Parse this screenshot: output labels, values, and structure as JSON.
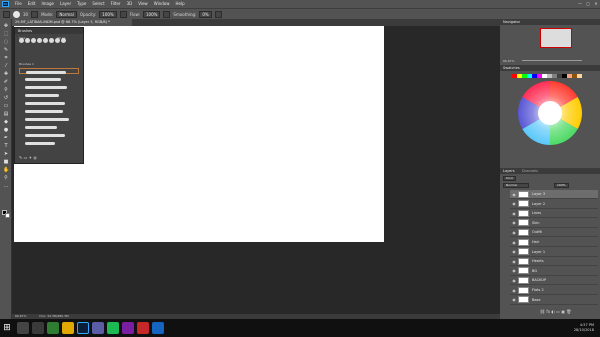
{
  "app": {
    "logo": "Ps",
    "menu": [
      "File",
      "Edit",
      "Image",
      "Layer",
      "Type",
      "Select",
      "Filter",
      "3D",
      "View",
      "Window",
      "Help"
    ],
    "window_controls": [
      "—",
      "▢",
      "✕"
    ]
  },
  "options": {
    "brush_size": "30",
    "mode_label": "Mode:",
    "mode_value": "Normal",
    "opacity_label": "Opacity:",
    "opacity_value": "100%",
    "flow_label": "Flow:",
    "flow_value": "100%",
    "smoothing_label": "Smoothing:",
    "smoothing_value": "0%"
  },
  "document": {
    "tab_title": "29-MF_LATINAS-INDM.psd @ 66.7% (Layer 3, RGB/8) *"
  },
  "brushes_panel": {
    "title": "Brushes",
    "size_label": "Size:",
    "size_value": "30 px",
    "folder_label": "Brushes 1"
  },
  "navigator": {
    "title": "Navigator",
    "zoom": "66.67%"
  },
  "color_panel": {
    "title": "Swatches"
  },
  "layers_panel": {
    "title": "Layers",
    "channels_tab": "Channels",
    "kind": "Kind",
    "blend": "Normal",
    "opacity": "100%",
    "layers": [
      {
        "name": "Layer 3",
        "selected": true
      },
      {
        "name": "Layer 2",
        "selected": false
      },
      {
        "name": "Lines",
        "selected": false
      },
      {
        "name": "Skin",
        "selected": false
      },
      {
        "name": "Outfit",
        "selected": false
      },
      {
        "name": "Hair",
        "selected": false
      },
      {
        "name": "Layer 1",
        "selected": false
      },
      {
        "name": "Hearts",
        "selected": false
      },
      {
        "name": "BG",
        "selected": false
      },
      {
        "name": "BACKUP",
        "selected": false
      },
      {
        "name": "Flats 2",
        "selected": false
      },
      {
        "name": "Base",
        "selected": false
      }
    ]
  },
  "status": {
    "zoom": "66.67%",
    "doc": "Doc: 34.3M/480.3M"
  },
  "taskbar": {
    "time": "4:57 PM",
    "date": "28/10/2018"
  }
}
